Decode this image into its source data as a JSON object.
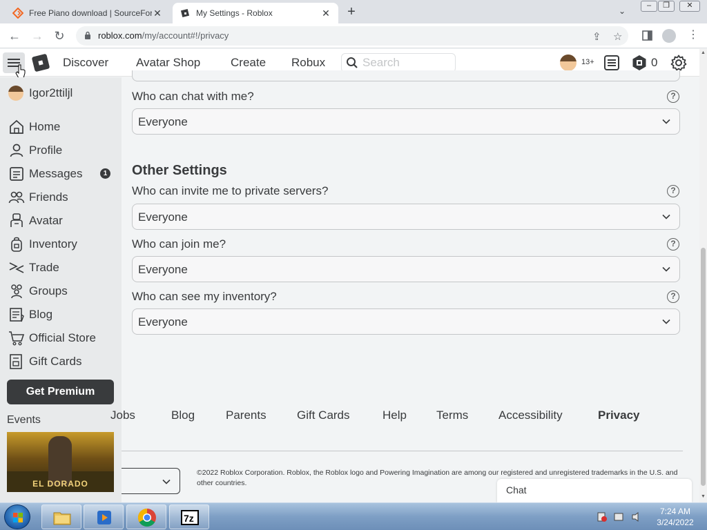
{
  "browser": {
    "tabs": [
      {
        "title": "Free Piano download | SourceFor",
        "active": false
      },
      {
        "title": "My Settings - Roblox",
        "active": true
      }
    ],
    "url_host": "roblox.com",
    "url_path": "/my/account#!/privacy"
  },
  "header": {
    "nav": [
      "Discover",
      "Avatar Shop",
      "Create",
      "Robux"
    ],
    "search_placeholder": "Search",
    "age_badge": "13+",
    "robux_count": "0"
  },
  "sidebar": {
    "username": "Igor2ttiljl",
    "items": [
      {
        "label": "Home",
        "icon": "home-icon"
      },
      {
        "label": "Profile",
        "icon": "profile-icon"
      },
      {
        "label": "Messages",
        "icon": "messages-icon",
        "badge": "1"
      },
      {
        "label": "Friends",
        "icon": "friends-icon"
      },
      {
        "label": "Avatar",
        "icon": "avatar-icon"
      },
      {
        "label": "Inventory",
        "icon": "inventory-icon"
      },
      {
        "label": "Trade",
        "icon": "trade-icon"
      },
      {
        "label": "Groups",
        "icon": "groups-icon"
      },
      {
        "label": "Blog",
        "icon": "blog-icon"
      },
      {
        "label": "Official Store",
        "icon": "store-icon"
      },
      {
        "label": "Gift Cards",
        "icon": "gift-cards-icon"
      }
    ],
    "premium_label": "Get Premium",
    "events_label": "Events",
    "event_banner_text": "EL DORADO"
  },
  "settings": {
    "chat": {
      "label": "Who can chat with me?",
      "value": "Everyone"
    },
    "other_title": "Other Settings",
    "private_servers": {
      "label": "Who can invite me to private servers?",
      "value": "Everyone"
    },
    "join": {
      "label": "Who can join me?",
      "value": "Everyone"
    },
    "inventory": {
      "label": "Who can see my inventory?",
      "value": "Everyone"
    }
  },
  "footer": {
    "links": [
      "Jobs",
      "Blog",
      "Parents",
      "Gift Cards",
      "Help",
      "Terms",
      "Accessibility",
      "Privacy"
    ],
    "copyright": "©2022 Roblox Corporation. Roblox, the Roblox logo and Powering Imagination are among our registered and unregistered trademarks in the U.S. and other countries."
  },
  "chat_label": "Chat",
  "taskbar": {
    "time": "7:24 AM",
    "date": "3/24/2022"
  },
  "colors": {
    "text": "#393b3d",
    "sidebar_bg": "#e8eaeb",
    "page_bg": "#f2f4f5",
    "premium_bg": "#393b3d"
  }
}
